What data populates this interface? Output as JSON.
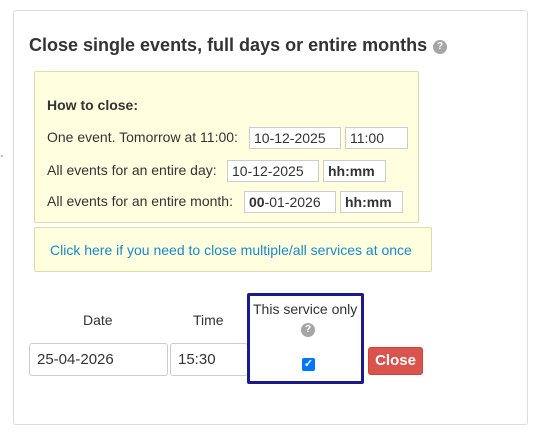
{
  "stray_mark": "·",
  "title": "Close single events, full days or entire months",
  "help_glyph": "?",
  "howto": {
    "heading": "How to close:",
    "rows": [
      {
        "label": "One event. Tomorrow at 11:00:",
        "date": "10-12-2025",
        "time": "11:00"
      },
      {
        "label": "All events for an entire day:",
        "date": "10-12-2025",
        "time": "hh:mm"
      },
      {
        "label": "All events for an entire month:",
        "date_bold": "00",
        "date_rest": "-01-2026",
        "time": "hh:mm"
      }
    ]
  },
  "multi_link": "Click here if you need to close multiple/all services at once",
  "form": {
    "date_label": "Date",
    "time_label": "Time",
    "date_value": "25-04-2026",
    "time_value": "15:30",
    "service_only_label": "This service only",
    "service_only_checked": true,
    "checkbox_glyph": "✓",
    "close_label": "Close"
  },
  "colors": {
    "link": "#1a88c9",
    "close_button": "#d9534f",
    "highlight_border": "#1a1a8c",
    "howto_background": "#ffffe0"
  }
}
